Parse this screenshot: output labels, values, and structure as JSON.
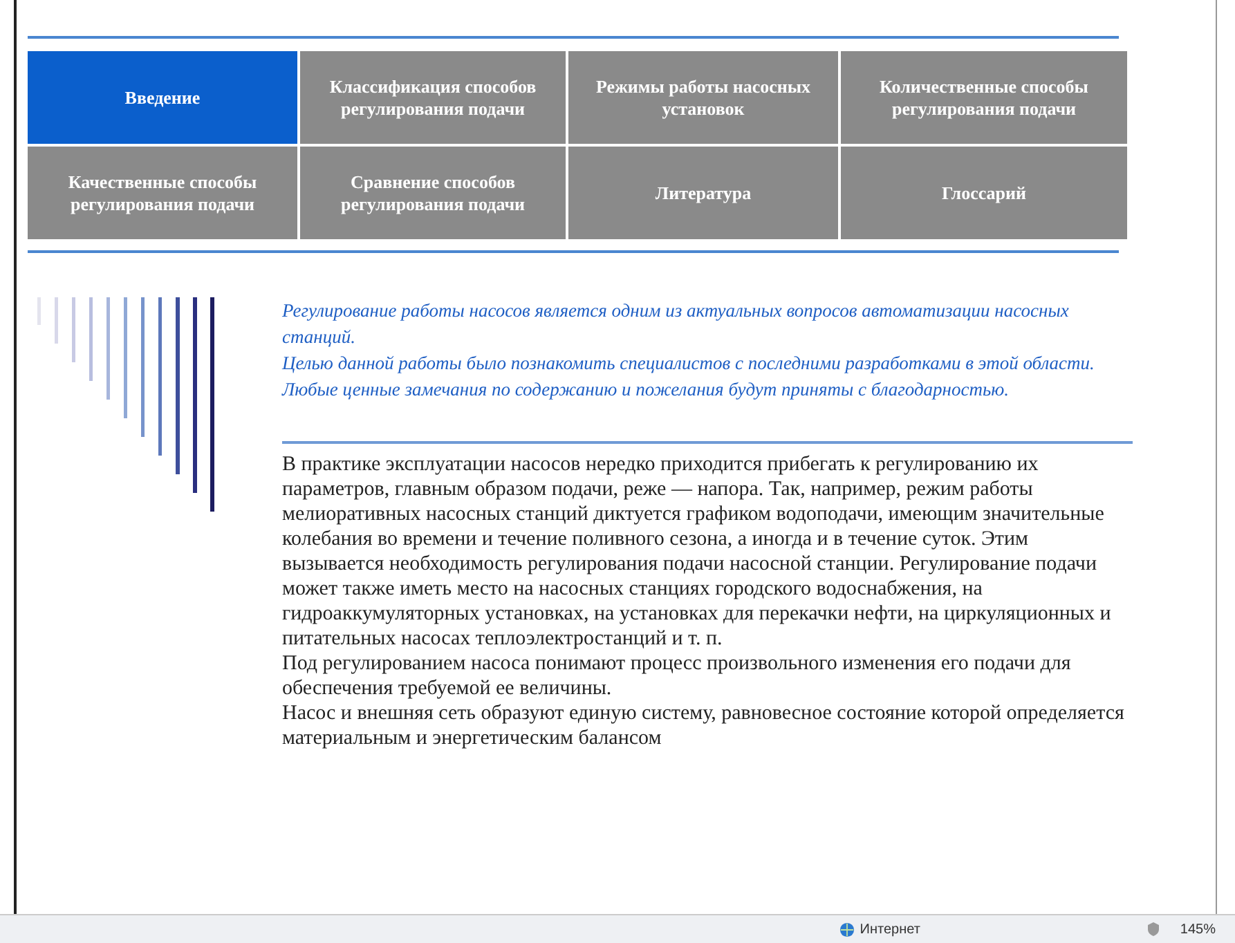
{
  "nav": [
    {
      "label": "Введение",
      "selected": true
    },
    {
      "label": "Классификация способов регулирования подачи",
      "selected": false
    },
    {
      "label": "Режимы работы насосных установок",
      "selected": false
    },
    {
      "label": "Количественные способы регулирования подачи",
      "selected": false
    },
    {
      "label": "Качественные способы регулирования подачи",
      "selected": false
    },
    {
      "label": "Сравнение способов регулирования подачи",
      "selected": false
    },
    {
      "label": "Литература",
      "selected": false
    },
    {
      "label": "Глоссарий",
      "selected": false
    }
  ],
  "intro": [
    "Регулирование работы насосов является одним из актуальных вопросов автоматизации насосных станций.",
    "Целью данной работы было познакомить специалистов с последними разработками в этой области.",
    "Любые ценные замечания по содержанию и пожелания будут приняты с благодарностью."
  ],
  "body": [
    "В практике эксплуатации насосов нередко приходится прибегать к регулированию их параметров, главным образом подачи, реже — напора. Так, например, режим работы мелиоративных насосных станций диктуется графиком водоподачи, имеющим значительные колебания во времени и течение поливного сезона, а иногда и в течение суток. Этим вызывается необходимость регулирования подачи насосной станции. Регулирование подачи может также иметь место на насосных станциях городского водоснабжения, на гидроаккумуляторных установках, на установках для перекачки нефти, на циркуляционных и питательных насосах теплоэлектростанций и т. п.",
    "Под регулированием насоса понимают процесс произвольного изменения его подачи для обеспечения требуемой ее величины.",
    "Насос и внешняя сеть образуют единую систему, равновесное состояние которой определяется материальным и энергетическим балансом"
  ],
  "status_bar": {
    "zone": "Интернет",
    "zoom": "145%"
  }
}
